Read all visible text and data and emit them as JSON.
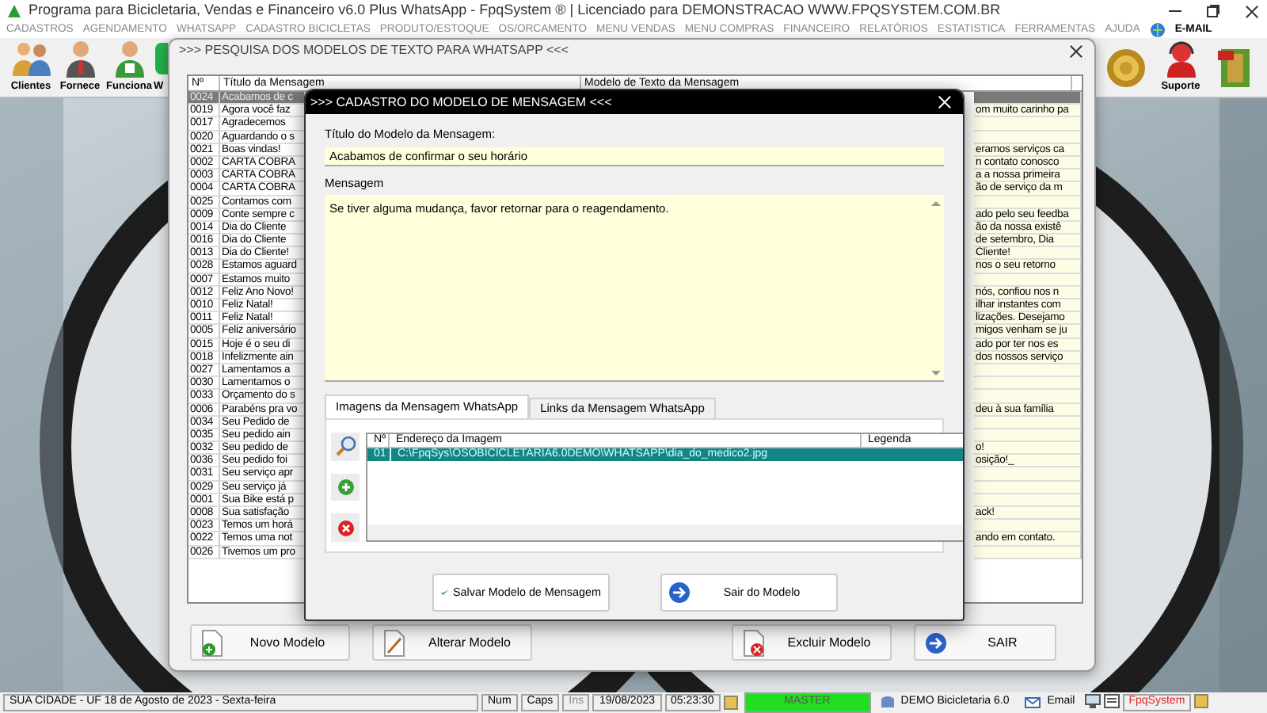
{
  "app_window": {
    "title": "Programa para Bicicletaria, Vendas e Financeiro v6.0 Plus WhatsApp - FpqSystem ® | Licenciado para  DEMONSTRACAO WWW.FPQSYSTEM.COM.BR"
  },
  "menu": [
    {
      "label": "CADASTROS",
      "disabled": true
    },
    {
      "label": "AGENDAMENTO",
      "disabled": true
    },
    {
      "label": "WHATSAPP",
      "disabled": true
    },
    {
      "label": "CADASTRO BICICLETAS",
      "disabled": true
    },
    {
      "label": "PRODUTO/ESTOQUE",
      "disabled": true
    },
    {
      "label": "OS/ORCAMENTO",
      "disabled": true
    },
    {
      "label": "MENU VENDAS",
      "disabled": true
    },
    {
      "label": "MENU COMPRAS",
      "disabled": true
    },
    {
      "label": "FINANCEIRO",
      "disabled": true
    },
    {
      "label": "RELATÓRIOS",
      "disabled": true
    },
    {
      "label": "ESTATISTICA",
      "disabled": true
    },
    {
      "label": "FERRAMENTAS",
      "disabled": true
    },
    {
      "label": "AJUDA",
      "disabled": true
    },
    {
      "label": "E-MAIL",
      "disabled": false,
      "kind": "email"
    }
  ],
  "toolbar_left": [
    {
      "kind": "clients",
      "label": "Clientes"
    },
    {
      "kind": "supplier",
      "label": "Fornece"
    },
    {
      "kind": "employee",
      "label": "Funciona"
    },
    {
      "kind": "whatsapp",
      "label": "W"
    }
  ],
  "toolbar_right": [
    {
      "kind": "coin"
    },
    {
      "kind": "support",
      "label": "Suporte"
    },
    {
      "kind": "exit"
    }
  ],
  "search_window": {
    "title": ">>> PESQUISA DOS MODELOS DE TEXTO PARA WHATSAPP <<<",
    "columns": [
      "Nº",
      "Título da Mensagem",
      "Modelo de Texto da Mensagem"
    ],
    "rows": [
      {
        "number": "0024",
        "title": "Acabamos de c",
        "selected": true
      },
      {
        "number": "0019",
        "title": "Agora você faz",
        "text": "om muito carinho pa",
        "selected": false
      },
      {
        "number": "0017",
        "title": "Agradecemos",
        "selected": false
      },
      {
        "number": "0020",
        "title": "Aguardando o s",
        "selected": false
      },
      {
        "number": "0021",
        "title": "Boas vindas!",
        "text": "eramos serviços ca",
        "selected": false
      },
      {
        "number": "0002",
        "title": "CARTA COBRA",
        "text": "n contato conosco",
        "selected": false
      },
      {
        "number": "0003",
        "title": "CARTA COBRA",
        "text": "a a nossa primeira",
        "selected": false
      },
      {
        "number": "0004",
        "title": "CARTA COBRA",
        "text": "ão de serviço da m",
        "selected": false
      },
      {
        "number": "0025",
        "title": "Contamos com",
        "selected": false
      },
      {
        "number": "0009",
        "title": "Conte sempre c",
        "text": "ado pelo seu feedba",
        "selected": false
      },
      {
        "number": "0014",
        "title": "Dia do Cliente",
        "text": "ão da nossa existê",
        "selected": false
      },
      {
        "number": "0016",
        "title": "Dia do Cliente",
        "text": "de setembro, Dia",
        "selected": false
      },
      {
        "number": "0013",
        "title": "Dia do Cliente!",
        "text": "Cliente!",
        "selected": false
      },
      {
        "number": "0028",
        "title": "Estamos aguard",
        "text": "nos o seu retorno",
        "selected": false
      },
      {
        "number": "0007",
        "title": "Estamos muito",
        "selected": false
      },
      {
        "number": "0012",
        "title": "Feliz Ano Novo!",
        "text": "nós, confiou nos n",
        "selected": false
      },
      {
        "number": "0010",
        "title": "Feliz Natal!",
        "text": "ilhar instantes com",
        "selected": false
      },
      {
        "number": "0011",
        "title": "Feliz Natal!",
        "text": "lizações. Desejamo",
        "selected": false
      },
      {
        "number": "0005",
        "title": "Feliz aniversário",
        "text": "migos venham se ju",
        "selected": false
      },
      {
        "number": "0015",
        "title": "Hoje é o seu di",
        "text": "ado por ter nos es",
        "selected": false
      },
      {
        "number": "0018",
        "title": "Infelizmente ain",
        "text": "dos nossos serviço",
        "selected": false
      },
      {
        "number": "0027",
        "title": "Lamentamos a",
        "selected": false
      },
      {
        "number": "0030",
        "title": "Lamentamos o",
        "selected": false
      },
      {
        "number": "0033",
        "title": "Orçamento do s",
        "selected": false
      },
      {
        "number": "0006",
        "title": "Parabéns pra vo",
        "text": "deu à sua família",
        "selected": false
      },
      {
        "number": "0034",
        "title": "Seu Pedido de",
        "selected": false
      },
      {
        "number": "0035",
        "title": "Seu pedido ain",
        "selected": false
      },
      {
        "number": "0032",
        "title": "Seu pedido de",
        "text": "o!",
        "selected": false
      },
      {
        "number": "0036",
        "title": "Seu pedido foi",
        "text": "osição!_",
        "selected": false
      },
      {
        "number": "0031",
        "title": "Seu serviço apr",
        "selected": false
      },
      {
        "number": "0029",
        "title": "Seu serviço já",
        "selected": false
      },
      {
        "number": "0001",
        "title": "Sua Bike está p",
        "selected": false
      },
      {
        "number": "0008",
        "title": "Sua satisfação",
        "text": "ack!",
        "selected": false
      },
      {
        "number": "0023",
        "title": "Temos um horá",
        "selected": false
      },
      {
        "number": "0022",
        "title": "Temos uma not",
        "text": "ando em contato.",
        "selected": false
      },
      {
        "number": "0026",
        "title": "Tivemos um pro",
        "selected": false
      }
    ],
    "buttons": [
      {
        "kind": "new",
        "label": "Novo Modelo"
      },
      {
        "kind": "edit",
        "label": "Alterar Modelo"
      },
      {
        "kind": "delete",
        "label": "Excluir Modelo"
      },
      {
        "kind": "exit",
        "label": "SAIR"
      }
    ]
  },
  "modal": {
    "title": ">>> CADASTRO DO MODELO DE MENSAGEM <<<",
    "title_label": "Título do Modelo da Mensagem:",
    "title_value": "Acabamos de confirmar o seu horário",
    "message_label": "Mensagem",
    "message_value": "Se tiver alguma mudança, favor retornar para o reagendamento.",
    "tabs": [
      {
        "label": "Imagens da Mensagem WhatsApp",
        "selected": true
      },
      {
        "label": "Links da Mensagem WhatsApp",
        "selected": false
      }
    ],
    "side_buttons": [
      {
        "kind": "search"
      },
      {
        "kind": "add"
      },
      {
        "kind": "remove"
      }
    ],
    "images_table": {
      "columns": [
        "Nº",
        "Endereço da Imagem",
        "Legenda"
      ],
      "rows": [
        {
          "number": "01",
          "path": "C:\\FpqSys\\OSOBICICLETARIA6.0DEMO\\WHATSAPP\\dia_do_medico2.jpg",
          "selected": true
        }
      ]
    },
    "buttons": [
      {
        "kind": "save",
        "label": "Salvar Modelo de Mensagem"
      },
      {
        "kind": "exit",
        "label": "Sair do Modelo"
      }
    ]
  },
  "status_bar": {
    "location": "SUA CIDADE - UF 18 de Agosto de 2023 - Sexta-feira",
    "keys": [
      {
        "label": "Num",
        "disabled": false
      },
      {
        "label": "Caps",
        "disabled": false
      },
      {
        "label": "Ins",
        "disabled": true
      }
    ],
    "date": "19/08/2023",
    "time": "05:23:30",
    "user": "MASTER",
    "company": "DEMO Bicicletaria 6.0",
    "email": "Email",
    "brand": "FpqSystem"
  }
}
